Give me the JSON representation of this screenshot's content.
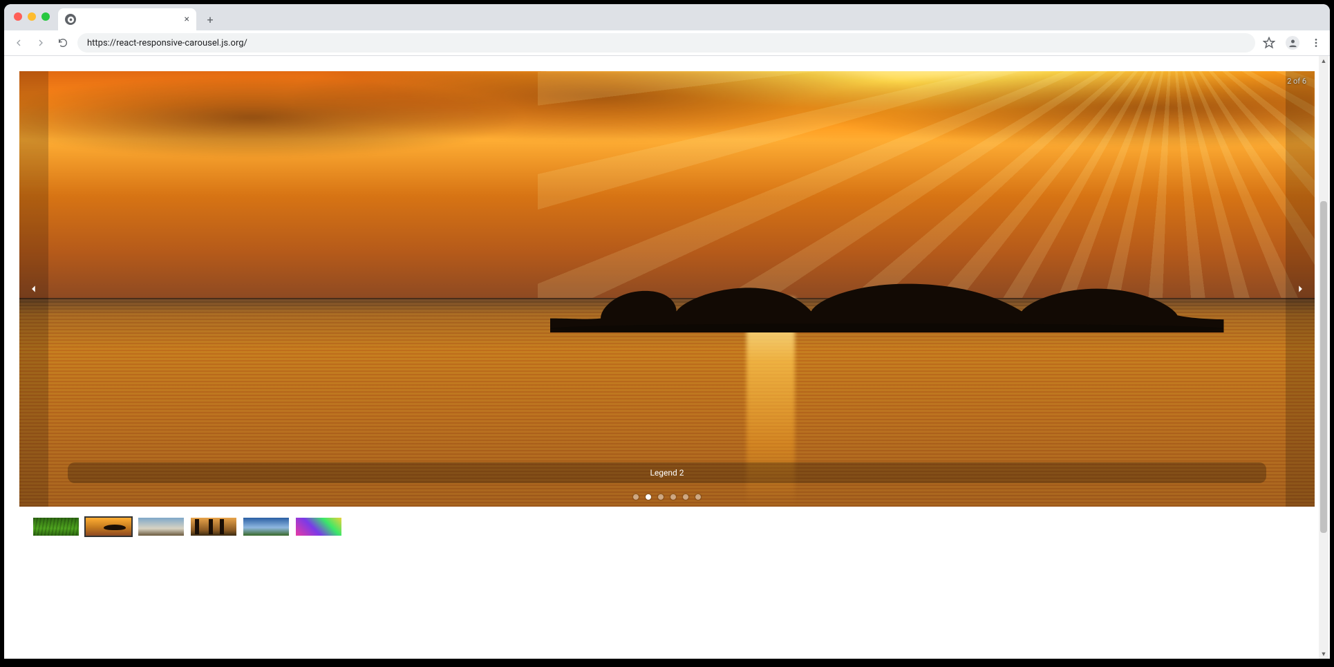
{
  "browser": {
    "url": "https://react-responsive-carousel.js.org/",
    "tab_title": ""
  },
  "carousel": {
    "current": 2,
    "total": 6,
    "status": "2 of 6",
    "legend": "Legend 2",
    "dots": [
      false,
      true,
      false,
      false,
      false,
      false
    ],
    "thumbs_selected_index": 1
  }
}
